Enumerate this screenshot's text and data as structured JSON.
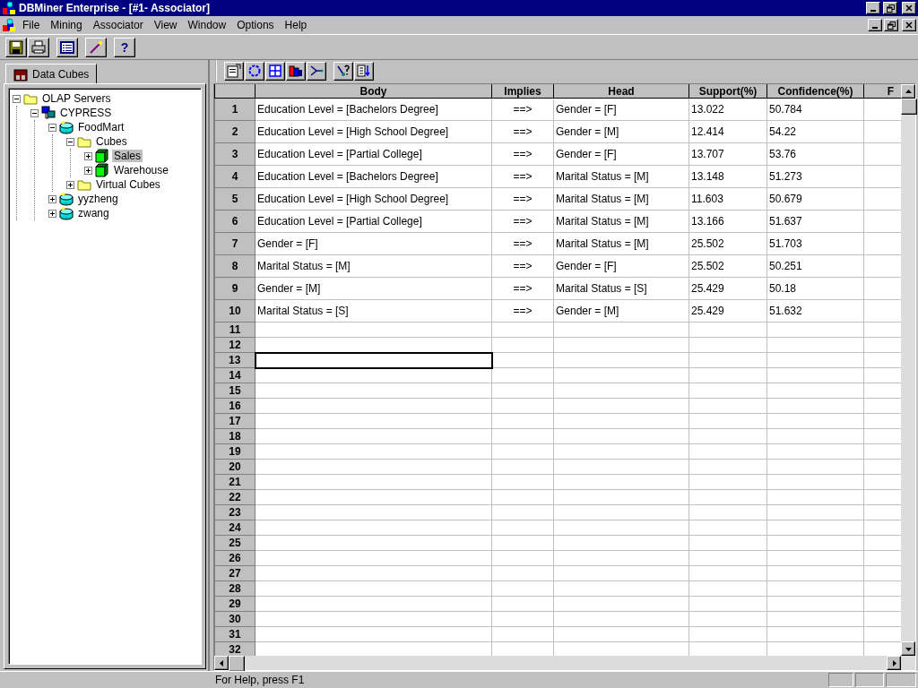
{
  "window": {
    "title": "DBMiner Enterprise - [#1- Associator]"
  },
  "menu": [
    {
      "label": "File"
    },
    {
      "label": "Mining"
    },
    {
      "label": "Associator"
    },
    {
      "label": "View"
    },
    {
      "label": "Window"
    },
    {
      "label": "Options"
    },
    {
      "label": "Help"
    }
  ],
  "toolbar": [
    {
      "kind": "save"
    },
    {
      "kind": "print"
    },
    {
      "kind": "list"
    },
    {
      "kind": "wand"
    },
    {
      "kind": "help",
      "label": "?"
    }
  ],
  "sidebar": {
    "tabs": [
      {
        "label": "Data Cubes",
        "selected": true
      }
    ],
    "tree": [
      {
        "label": "OLAP Servers",
        "kind": "folder",
        "expanded": true,
        "selected": false,
        "children": [
          {
            "label": "CYPRESS",
            "kind": "server",
            "expanded": true,
            "selected": false,
            "children": [
              {
                "label": "FoodMart",
                "kind": "database",
                "expanded": true,
                "selected": false,
                "children": [
                  {
                    "label": "Cubes",
                    "kind": "folder",
                    "expanded": true,
                    "selected": false,
                    "children": [
                      {
                        "label": "Sales",
                        "kind": "cube",
                        "expanded": false,
                        "selected": true
                      },
                      {
                        "label": "Warehouse",
                        "kind": "cube",
                        "expanded": false,
                        "selected": false
                      }
                    ]
                  },
                  {
                    "label": "Virtual Cubes",
                    "kind": "folder",
                    "expanded": false,
                    "selected": false
                  }
                ]
              },
              {
                "label": "yyzheng",
                "kind": "database",
                "expanded": false,
                "selected": false
              },
              {
                "label": "zwang",
                "kind": "database",
                "expanded": false,
                "selected": false
              }
            ]
          }
        ]
      }
    ]
  },
  "associator_toolbar": [
    {
      "kind": "properties"
    },
    {
      "kind": "ring"
    },
    {
      "kind": "grid"
    },
    {
      "kind": "bars"
    },
    {
      "kind": "branch"
    },
    {
      "kind": "query"
    },
    {
      "kind": "sort"
    }
  ],
  "table": {
    "columns": [
      "Body",
      "Implies",
      "Head",
      "Support(%)",
      "Confidence(%)",
      "F"
    ],
    "rows": [
      {
        "number": "1",
        "selected": false,
        "cells": [
          "Education Level = [Bachelors Degree]",
          "==>",
          "Gender = [F]",
          "13.022",
          "50.784"
        ]
      },
      {
        "number": "2",
        "selected": false,
        "cells": [
          "Education Level = [High School Degree]",
          "==>",
          "Gender = [M]",
          "12.414",
          "54.22"
        ]
      },
      {
        "number": "3",
        "selected": false,
        "cells": [
          "Education Level = [Partial College]",
          "==>",
          "Gender = [F]",
          "13.707",
          "53.76"
        ]
      },
      {
        "number": "4",
        "selected": false,
        "cells": [
          "Education Level = [Bachelors Degree]",
          "==>",
          "Marital Status = [M]",
          "13.148",
          "51.273"
        ]
      },
      {
        "number": "5",
        "selected": false,
        "cells": [
          "Education Level = [High School Degree]",
          "==>",
          "Marital Status = [M]",
          "11.603",
          "50.679"
        ]
      },
      {
        "number": "6",
        "selected": false,
        "cells": [
          "Education Level = [Partial College]",
          "==>",
          "Marital Status = [M]",
          "13.166",
          "51.637"
        ]
      },
      {
        "number": "7",
        "selected": false,
        "cells": [
          "Gender = [F]",
          "==>",
          "Marital Status = [M]",
          "25.502",
          "51.703"
        ]
      },
      {
        "number": "8",
        "selected": false,
        "cells": [
          "Marital Status = [M]",
          "==>",
          "Gender = [F]",
          "25.502",
          "50.251"
        ]
      },
      {
        "number": "9",
        "selected": false,
        "cells": [
          "Gender = [M]",
          "==>",
          "Marital Status = [S]",
          "25.429",
          "50.18"
        ]
      },
      {
        "number": "10",
        "selected": false,
        "cells": [
          "Marital Status = [S]",
          "==>",
          "Gender = [M]",
          "25.429",
          "51.632"
        ]
      },
      {
        "number": "11",
        "selected": false
      },
      {
        "number": "12",
        "selected": false
      },
      {
        "number": "13",
        "selected": true
      },
      {
        "number": "14",
        "selected": false
      },
      {
        "number": "15",
        "selected": false
      },
      {
        "number": "16",
        "selected": false
      },
      {
        "number": "17",
        "selected": false
      },
      {
        "number": "18",
        "selected": false
      },
      {
        "number": "19",
        "selected": false
      },
      {
        "number": "20",
        "selected": false
      },
      {
        "number": "21",
        "selected": false
      },
      {
        "number": "22",
        "selected": false
      },
      {
        "number": "23",
        "selected": false
      },
      {
        "number": "24",
        "selected": false
      },
      {
        "number": "25",
        "selected": false
      },
      {
        "number": "26",
        "selected": false
      },
      {
        "number": "27",
        "selected": false
      },
      {
        "number": "28",
        "selected": false
      },
      {
        "number": "29",
        "selected": false
      },
      {
        "number": "30",
        "selected": false
      },
      {
        "number": "31",
        "selected": false
      },
      {
        "number": "32",
        "selected": false
      }
    ]
  },
  "status_bar": {
    "text": "For Help, press F1"
  }
}
